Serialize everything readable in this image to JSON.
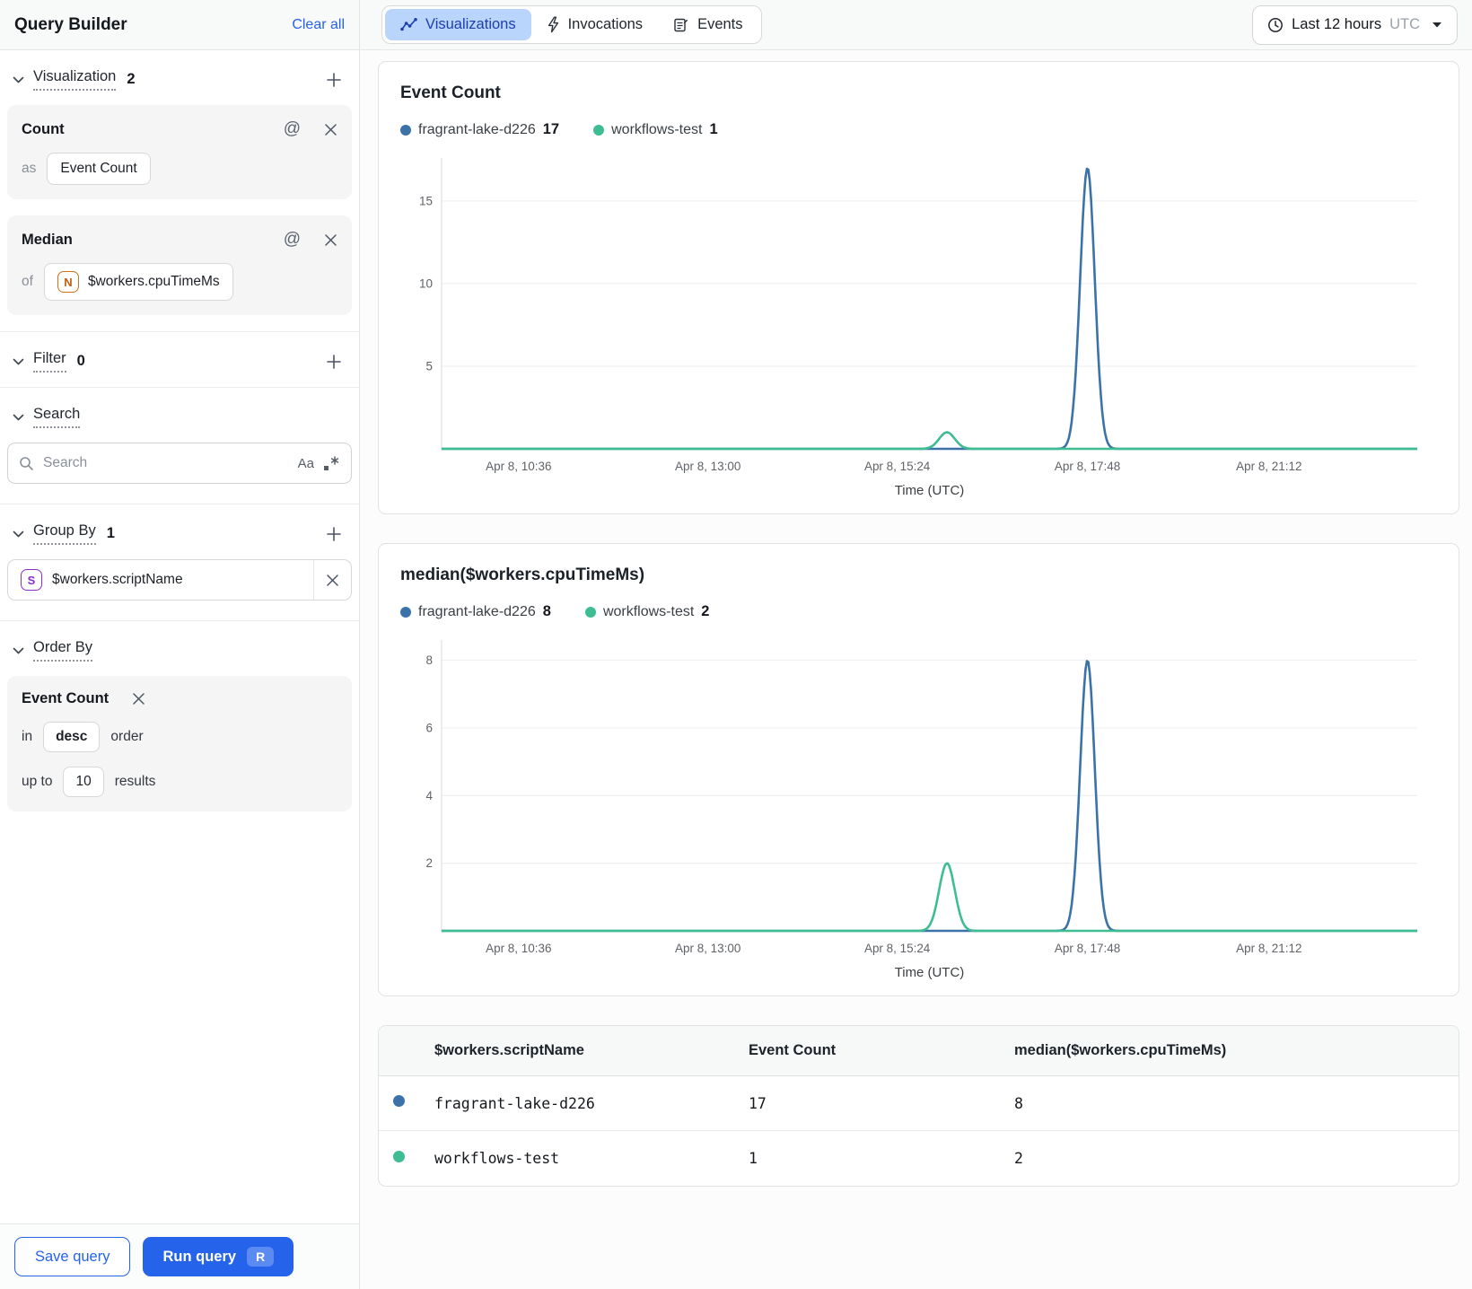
{
  "sidebar": {
    "title": "Query Builder",
    "clear_all": "Clear all",
    "visualization": {
      "label": "Visualization",
      "count": "2",
      "cards": [
        {
          "title": "Count",
          "prefix": "as",
          "value": "Event Count"
        },
        {
          "title": "Median",
          "prefix": "of",
          "badge": "N",
          "value": "$workers.cpuTimeMs"
        }
      ]
    },
    "filter": {
      "label": "Filter",
      "count": "0"
    },
    "search": {
      "label": "Search",
      "placeholder": "Search",
      "case_toggle": "Aa"
    },
    "group_by": {
      "label": "Group By",
      "count": "1",
      "badge": "S",
      "value": "$workers.scriptName"
    },
    "order_by": {
      "label": "Order By",
      "field": "Event Count",
      "in_label": "in",
      "direction": "desc",
      "order_label": "order",
      "up_to_label": "up to",
      "limit": "10",
      "results_label": "results"
    },
    "save_button": "Save query",
    "run_button": "Run query",
    "run_shortcut": "R"
  },
  "topbar": {
    "tabs": [
      {
        "label": "Visualizations",
        "active": true
      },
      {
        "label": "Invocations",
        "active": false
      },
      {
        "label": "Events",
        "active": false
      }
    ],
    "time_range": {
      "label": "Last 12 hours",
      "zone": "UTC"
    }
  },
  "chart_data": [
    {
      "type": "line",
      "title": "Event Count",
      "xlabel": "Time (UTC)",
      "ylim": [
        0,
        17.6
      ],
      "y_ticks": [
        5,
        10,
        15
      ],
      "x_ticks": [
        {
          "label": "Apr 8, 10:36",
          "pos": 0.079
        },
        {
          "label": "Apr 8, 13:00",
          "pos": 0.273
        },
        {
          "label": "Apr 8, 15:24",
          "pos": 0.467
        },
        {
          "label": "Apr 8, 17:48",
          "pos": 0.662
        },
        {
          "label": "Apr 8, 21:12",
          "pos": 0.848
        }
      ],
      "series": [
        {
          "name": "fragrant-lake-d226",
          "legend_value": "17",
          "color": "#3b73a8",
          "baseline": 0,
          "peaks": [
            {
              "pos": 0.662,
              "value": 17,
              "sigma": 0.0075,
              "time": "Apr 8, ~17:48"
            }
          ]
        },
        {
          "name": "workflows-test",
          "legend_value": "1",
          "color": "#3fbd92",
          "baseline": 0,
          "peaks": [
            {
              "pos": 0.518,
              "value": 1,
              "sigma": 0.008,
              "time": "Apr 8, ~15:40"
            }
          ]
        }
      ],
      "legend_position": "top"
    },
    {
      "type": "line",
      "title": "median($workers.cpuTimeMs)",
      "xlabel": "Time (UTC)",
      "ylim": [
        0,
        8.6
      ],
      "y_ticks": [
        2,
        4,
        6,
        8
      ],
      "x_ticks": [
        {
          "label": "Apr 8, 10:36",
          "pos": 0.079
        },
        {
          "label": "Apr 8, 13:00",
          "pos": 0.273
        },
        {
          "label": "Apr 8, 15:24",
          "pos": 0.467
        },
        {
          "label": "Apr 8, 17:48",
          "pos": 0.662
        },
        {
          "label": "Apr 8, 21:12",
          "pos": 0.848
        }
      ],
      "series": [
        {
          "name": "fragrant-lake-d226",
          "legend_value": "8",
          "color": "#3b73a8",
          "baseline": 0,
          "peaks": [
            {
              "pos": 0.662,
              "value": 8,
              "sigma": 0.0075,
              "time": "Apr 8, ~17:48"
            }
          ]
        },
        {
          "name": "workflows-test",
          "legend_value": "2",
          "color": "#3fbd92",
          "baseline": 0,
          "peaks": [
            {
              "pos": 0.518,
              "value": 2,
              "sigma": 0.008,
              "time": "Apr 8, ~15:40"
            }
          ]
        }
      ],
      "legend_position": "top"
    }
  ],
  "table": {
    "columns": [
      "$workers.scriptName",
      "Event Count",
      "median($workers.cpuTimeMs)"
    ],
    "rows": [
      {
        "color": "#3b73a8",
        "cells": [
          "fragrant-lake-d226",
          "17",
          "8"
        ]
      },
      {
        "color": "#3fbd92",
        "cells": [
          "workflows-test",
          "1",
          "2"
        ]
      }
    ]
  }
}
